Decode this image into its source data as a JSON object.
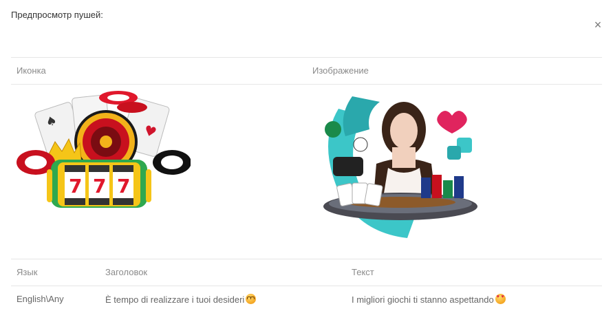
{
  "modal": {
    "title": "Предпросмотр пушей:",
    "close_label": "×"
  },
  "media": {
    "icon_header": "Иконка",
    "image_header": "Изображение"
  },
  "table": {
    "headers": {
      "language": "Язык",
      "title": "Заголовок",
      "text": "Текст"
    },
    "rows": [
      {
        "language": "English\\Any",
        "title": "È tempo di realizzare i tuoi desideri",
        "title_emoji": "smiling-face-with-hearts-emoji",
        "text": "I migliori giochi ti stanno aspettando",
        "text_emoji": "heart-eyes-emoji"
      }
    ]
  },
  "colors": {
    "divider": "#e6e6e6",
    "header_text": "#8a8a8a",
    "body_text": "#666666"
  }
}
